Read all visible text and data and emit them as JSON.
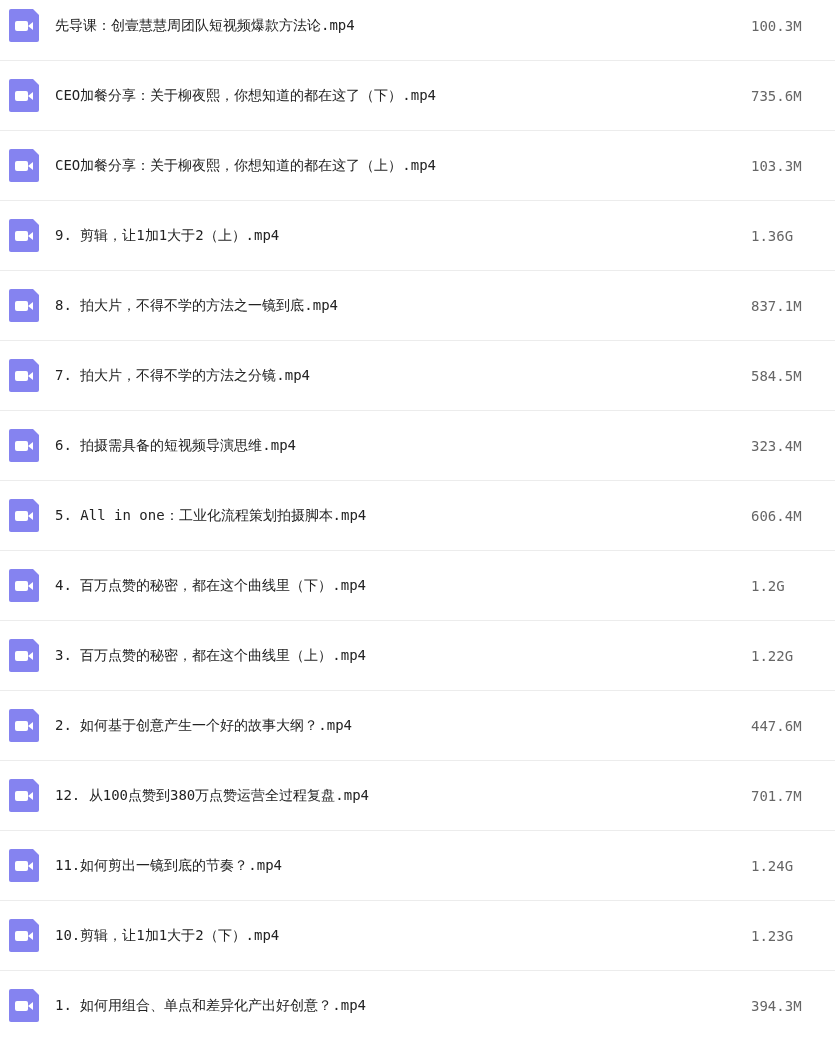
{
  "files": [
    {
      "name": "先导课：创壹慧慧周团队短视频爆款方法论.mp4",
      "size": "100.3M"
    },
    {
      "name": "CEO加餐分享：关于柳夜熙，你想知道的都在这了（下）.mp4",
      "size": "735.6M"
    },
    {
      "name": "CEO加餐分享：关于柳夜熙，你想知道的都在这了（上）.mp4",
      "size": "103.3M"
    },
    {
      "name": "9. 剪辑，让1加1大于2（上）.mp4",
      "size": "1.36G"
    },
    {
      "name": "8. 拍大片，不得不学的方法之一镜到底.mp4",
      "size": "837.1M"
    },
    {
      "name": "7. 拍大片，不得不学的方法之分镜.mp4",
      "size": "584.5M"
    },
    {
      "name": "6. 拍摄需具备的短视频导演思维.mp4",
      "size": "323.4M"
    },
    {
      "name": "5. All in one：工业化流程策划拍摄脚本.mp4",
      "size": "606.4M"
    },
    {
      "name": "4. 百万点赞的秘密，都在这个曲线里（下）.mp4",
      "size": "1.2G"
    },
    {
      "name": "3. 百万点赞的秘密，都在这个曲线里（上）.mp4",
      "size": "1.22G"
    },
    {
      "name": "2. 如何基于创意产生一个好的故事大纲？.mp4",
      "size": "447.6M"
    },
    {
      "name": "12. 从100点赞到380万点赞运营全过程复盘.mp4",
      "size": "701.7M"
    },
    {
      "name": "11.如何剪出一镜到底的节奏？.mp4",
      "size": "1.24G"
    },
    {
      "name": "10.剪辑，让1加1大于2（下）.mp4",
      "size": "1.23G"
    },
    {
      "name": "1. 如何用组合、单点和差异化产出好创意？.mp4",
      "size": "394.3M"
    }
  ]
}
